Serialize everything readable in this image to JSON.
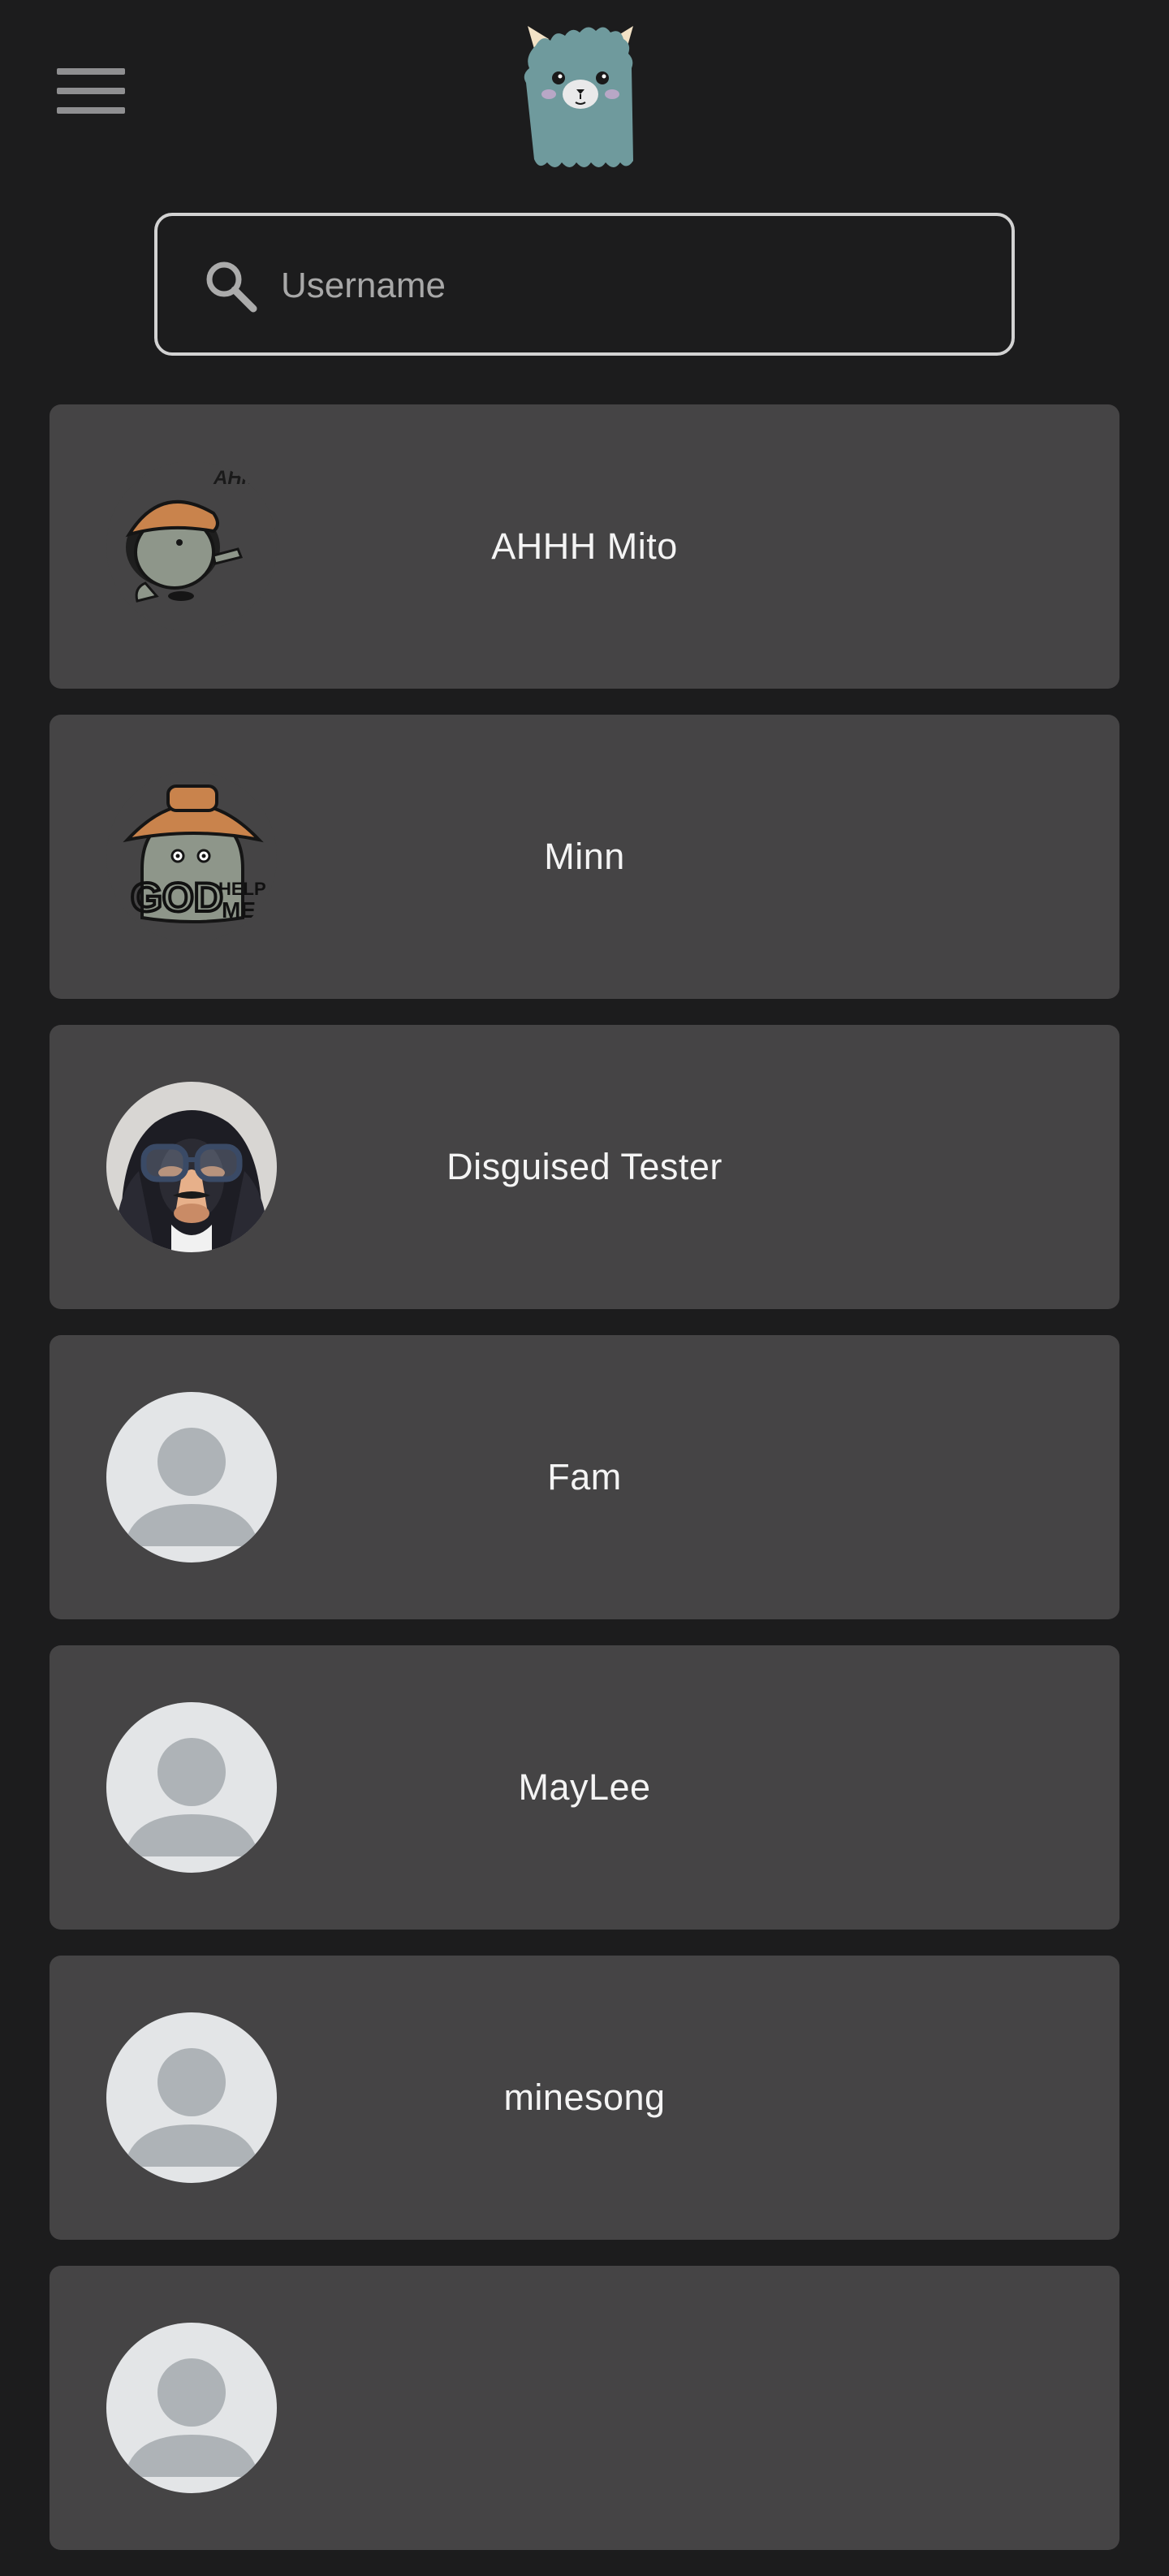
{
  "app": {
    "logo_icon": "alpaca-logo-icon",
    "menu_icon": "hamburger-menu-icon"
  },
  "search": {
    "placeholder": "Username",
    "value": "",
    "icon": "search-icon"
  },
  "users": [
    {
      "name": "AHHH Mito",
      "avatar": "mushroom-character-ahh-sticker",
      "sticker_text": "AHh."
    },
    {
      "name": "Minn",
      "avatar": "mushroom-character-god-help-me-sticker",
      "sticker_text": "GOD HELP ME"
    },
    {
      "name": "Disguised Tester",
      "avatar": "dog-with-disguise-glasses-photo"
    },
    {
      "name": "Fam",
      "avatar": "default-user-avatar"
    },
    {
      "name": "MayLee",
      "avatar": "default-user-avatar"
    },
    {
      "name": "minesong",
      "avatar": "default-user-avatar"
    },
    {
      "name": "",
      "avatar": "default-user-avatar"
    }
  ],
  "colors": {
    "background": "#1c1c1d",
    "card": "#454445",
    "text": "#f4f4f4",
    "search_border": "#d2d2d2",
    "placeholder": "#a8a8a8",
    "logo_teal": "#6f9a9d",
    "default_avatar_bg": "#e3e5e7",
    "default_avatar_fg": "#aeb3b7"
  }
}
